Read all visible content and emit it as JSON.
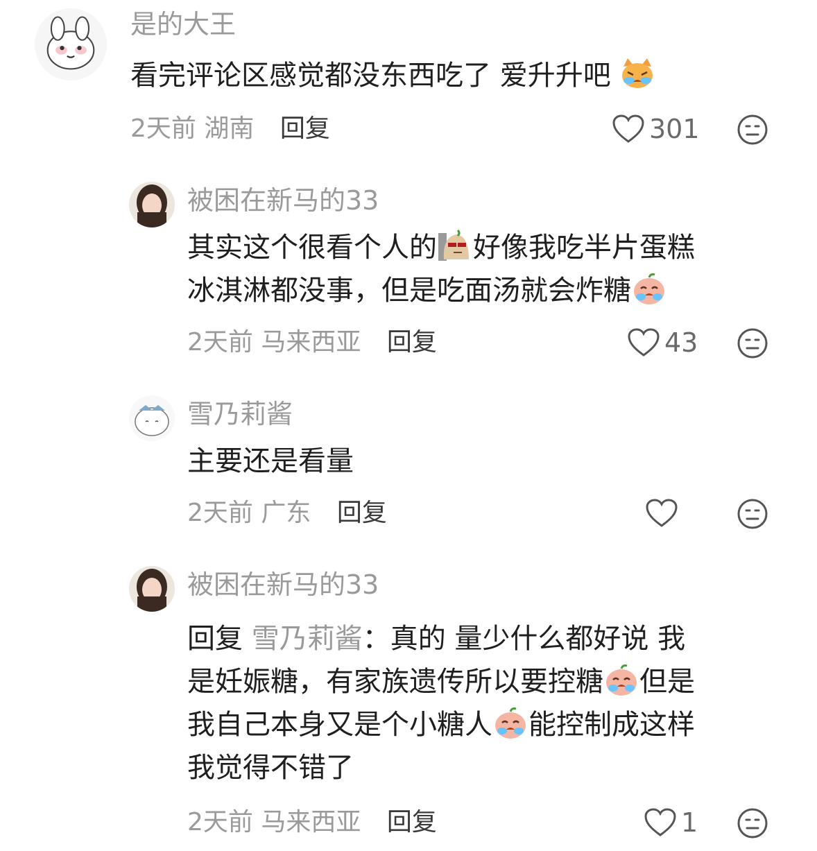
{
  "comments": [
    {
      "username": "是的大王",
      "lines": [
        "看完评论区感觉都没东西吃了 爱升升吧"
      ],
      "time": "2天前",
      "location": "湖南",
      "reply_label": "回复",
      "likes": "301"
    },
    {
      "username": "被困在新马的33",
      "line1a": "其实这个很看个人的",
      "line1b": "好像我吃半片蛋糕",
      "line2": "冰淇淋都没事，但是吃面汤就会炸糖",
      "time": "2天前",
      "location": "马来西亚",
      "reply_label": "回复",
      "likes": "43"
    },
    {
      "username": "雪乃莉酱",
      "lines": [
        "主要还是看量"
      ],
      "time": "2天前",
      "location": "广东",
      "reply_label": "回复",
      "likes": ""
    },
    {
      "username": "被困在新马的33",
      "reply_prefix": "回复",
      "reply_target": "雪乃莉酱",
      "line1_rest": "：真的 量少什么都好说 我",
      "line2a": "是妊娠糖，有家族遗传所以要控糖",
      "line2b": "但是",
      "line3a": "我自己本身又是个小糖人",
      "line3b": "能控制成这样",
      "line4": "我觉得不错了",
      "time": "2天前",
      "location": "马来西亚",
      "reply_label": "回复",
      "likes": "1"
    }
  ],
  "icons": {
    "like": "heart-outline-icon",
    "dislike": "neutral-face-icon"
  },
  "colors": {
    "username": "#9a9a9a",
    "text": "#1f1f1f",
    "meta": "#9a9a9a"
  }
}
